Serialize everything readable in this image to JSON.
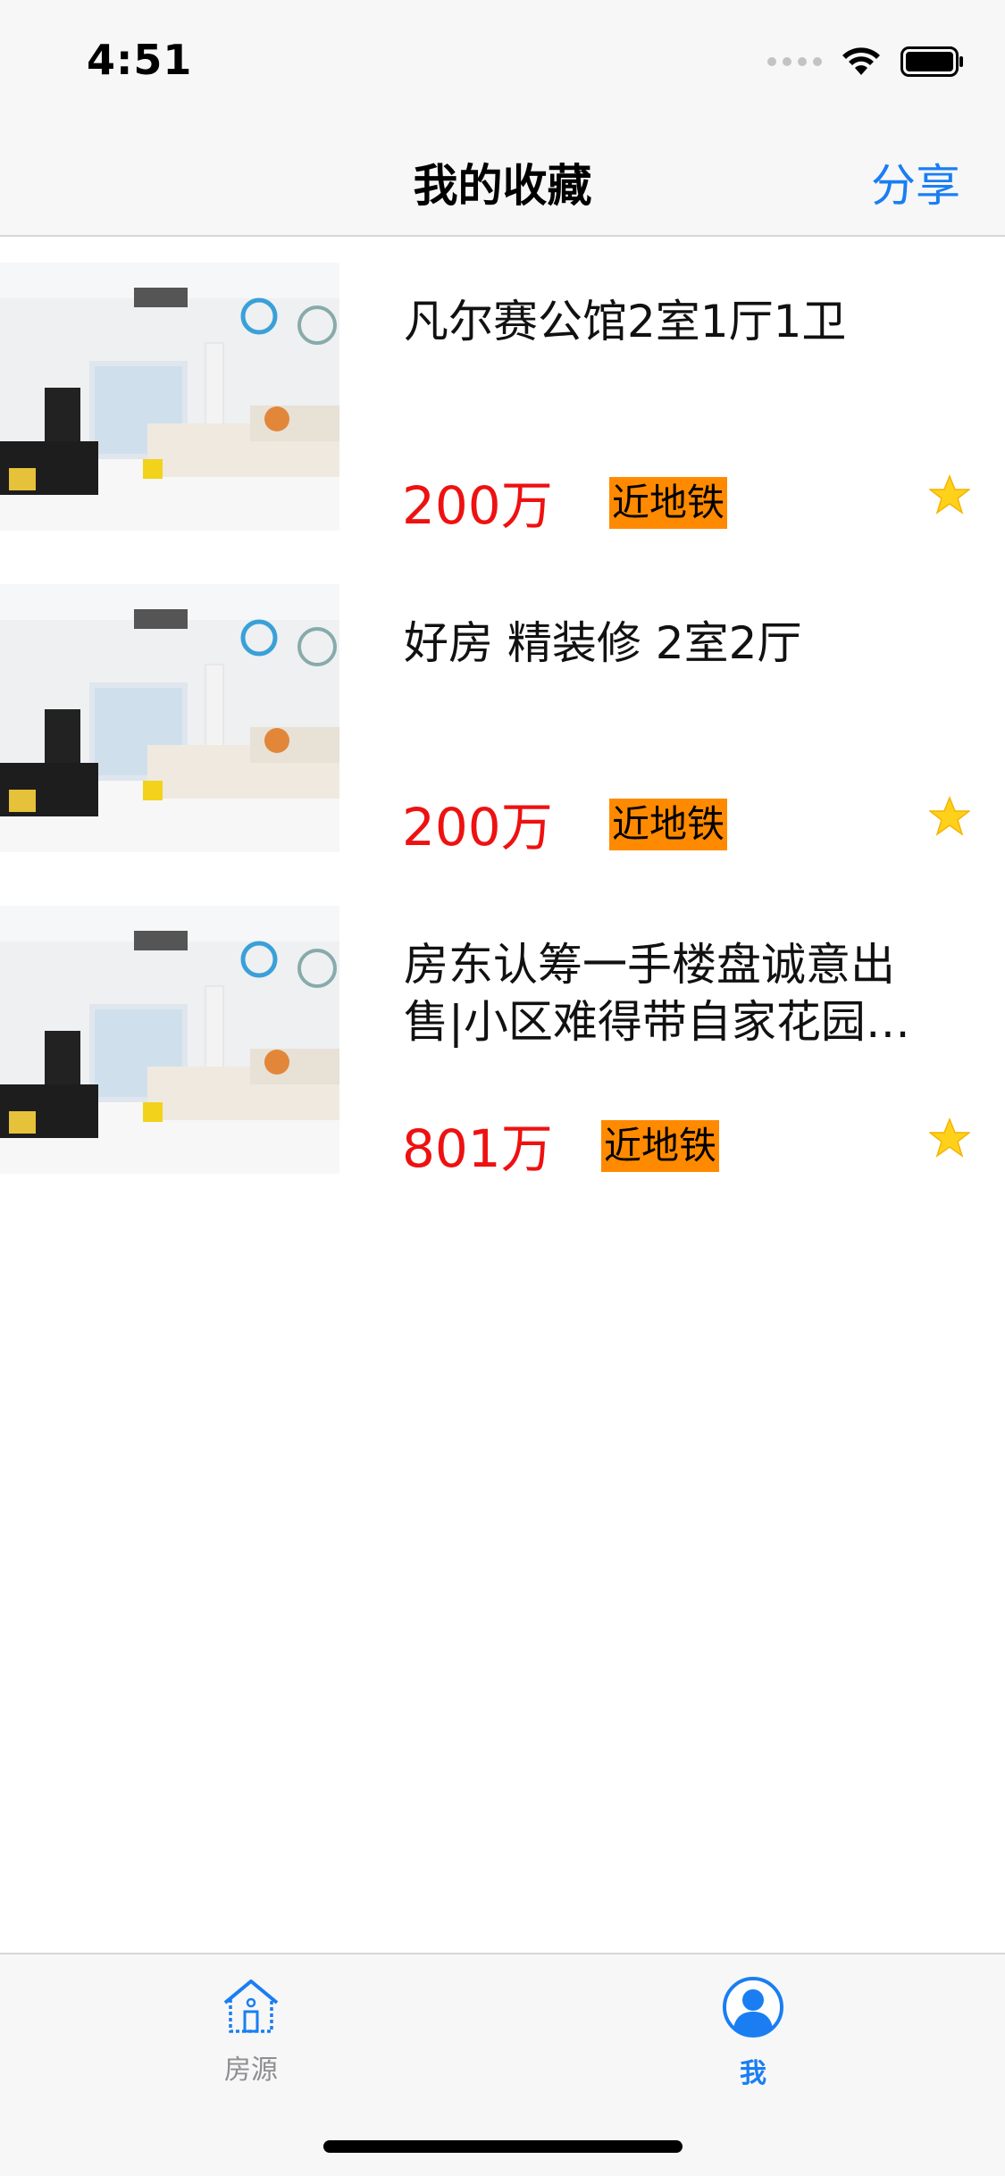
{
  "status_bar": {
    "time": "4:51"
  },
  "nav": {
    "title": "我的收藏",
    "share_label": "分享"
  },
  "listings": [
    {
      "title": "凡尔赛公馆2室1厅1卫",
      "price": "200万",
      "tag": "近地铁"
    },
    {
      "title": "好房 精装修 2室2厅",
      "price": "200万",
      "tag": "近地铁"
    },
    {
      "title": "房东认筹一手楼盘诚意出售|小区难得带自家花园…",
      "price": "801万",
      "tag": "近地铁"
    }
  ],
  "tabbar": {
    "items": [
      {
        "label": "房源",
        "icon": "house-icon",
        "active": false
      },
      {
        "label": "我",
        "icon": "person-icon",
        "active": true
      }
    ]
  },
  "colors": {
    "accent": "#1a7ef2",
    "price": "#ee1111",
    "badge": "#ff8a00",
    "star": "#ffd11a",
    "tab_inactive": "#8e8e93"
  }
}
